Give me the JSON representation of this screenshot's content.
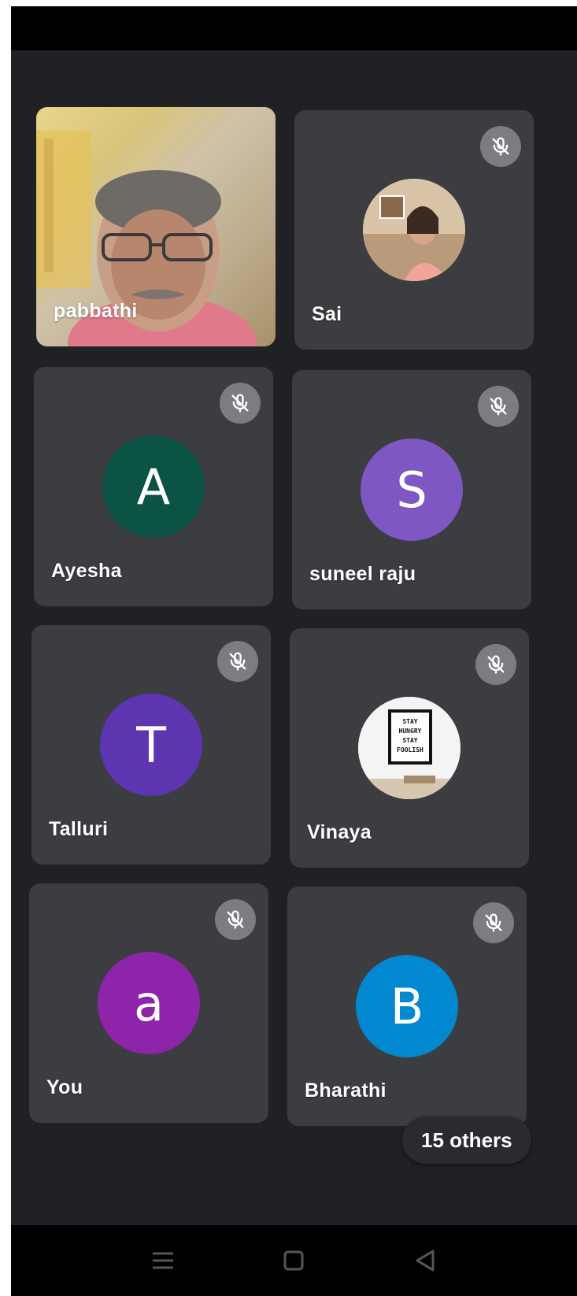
{
  "participants": [
    {
      "name": "pabbathi",
      "type": "video",
      "muted": false
    },
    {
      "name": "Sai",
      "type": "photo",
      "muted": true
    },
    {
      "name": "Ayesha",
      "initial": "A",
      "color": "#0b5345",
      "muted": true
    },
    {
      "name": "suneel raju",
      "initial": "S",
      "color": "#7e57c2",
      "muted": true
    },
    {
      "name": "Talluri",
      "initial": "T",
      "color": "#5e35b1",
      "muted": true
    },
    {
      "name": "Vinaya",
      "type": "photo",
      "photo_text": [
        "STAY",
        "HUNGRY",
        "STAY",
        "FOOLISH"
      ],
      "muted": true
    },
    {
      "name": "You",
      "initial": "a",
      "color": "#8e24aa",
      "muted": true
    },
    {
      "name": "Bharathi",
      "initial": "B",
      "color": "#0288d1",
      "muted": true
    }
  ],
  "others_label": "15 others",
  "icons": {
    "mute": "mic-off-icon",
    "nav": [
      "menu-icon",
      "home-icon",
      "back-icon"
    ]
  }
}
